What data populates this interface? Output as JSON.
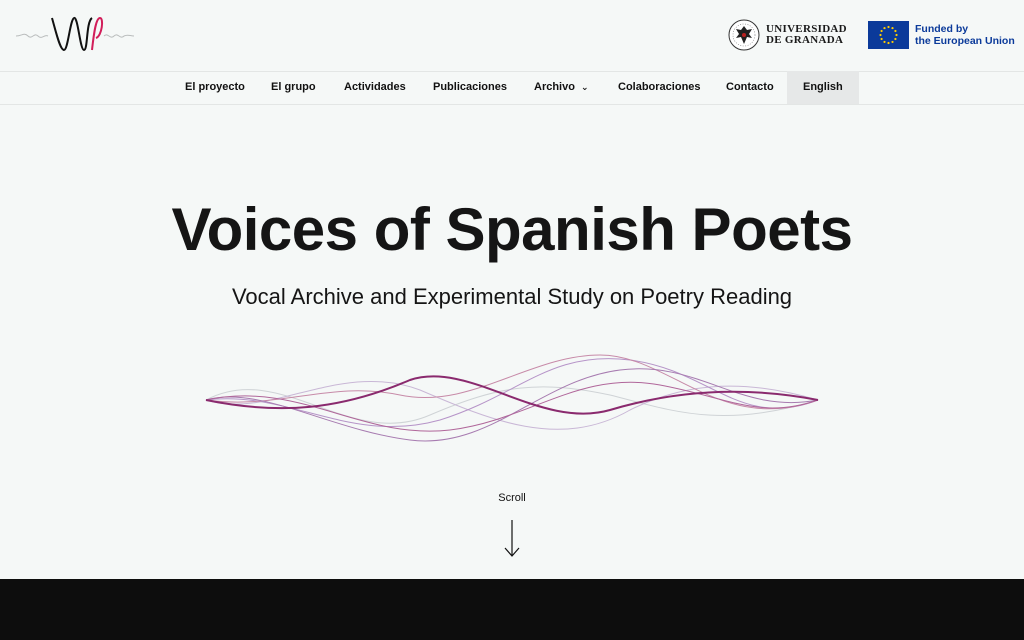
{
  "header": {
    "logo_name": "vsp-logo",
    "university": {
      "line1": "UNIVERSIDAD",
      "line2": "DE GRANADA"
    },
    "eu": {
      "line1": "Funded by",
      "line2": "the European Union"
    }
  },
  "nav": {
    "items": [
      {
        "label": "El proyecto"
      },
      {
        "label": "El grupo"
      },
      {
        "label": "Actividades"
      },
      {
        "label": "Publicaciones"
      },
      {
        "label": "Archivo"
      },
      {
        "label": "Colaboraciones"
      },
      {
        "label": "Contacto"
      },
      {
        "label": "English"
      }
    ]
  },
  "hero": {
    "title": "Voices of Spanish Poets",
    "subtitle": "Vocal Archive and Experimental Study on Poetry Reading"
  },
  "scroll_label": "Scroll",
  "colors": {
    "accent": "#8a2a6e",
    "background": "#f5f8f7",
    "dark_band": "#0d0d0d",
    "eu_blue": "#0b3a9a"
  }
}
